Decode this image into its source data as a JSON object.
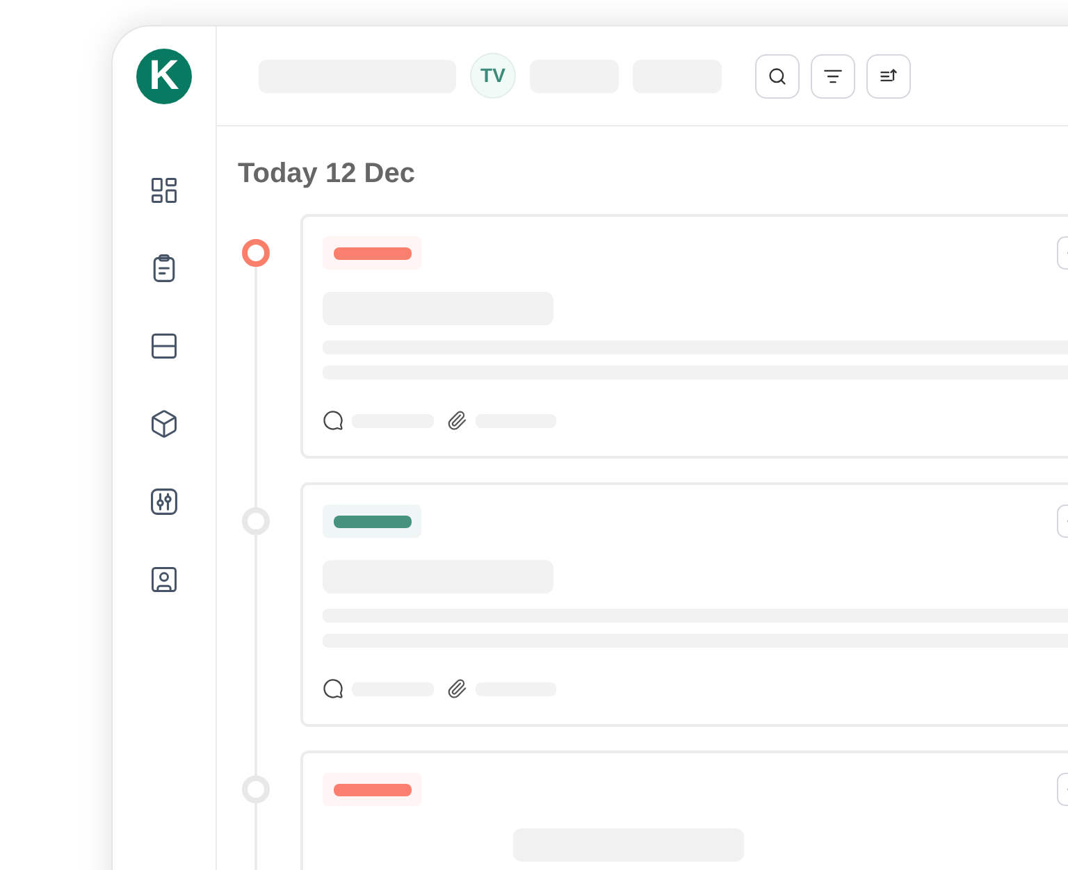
{
  "logo": {
    "letter": "K"
  },
  "header": {
    "avatar": "TV"
  },
  "day_heading": "Today 12 Dec",
  "timeline": [
    {
      "active": true,
      "color": "#fb7f6e"
    },
    {
      "active": false,
      "color": "#46927f"
    },
    {
      "active": false,
      "color": "#fb7f6e"
    }
  ]
}
